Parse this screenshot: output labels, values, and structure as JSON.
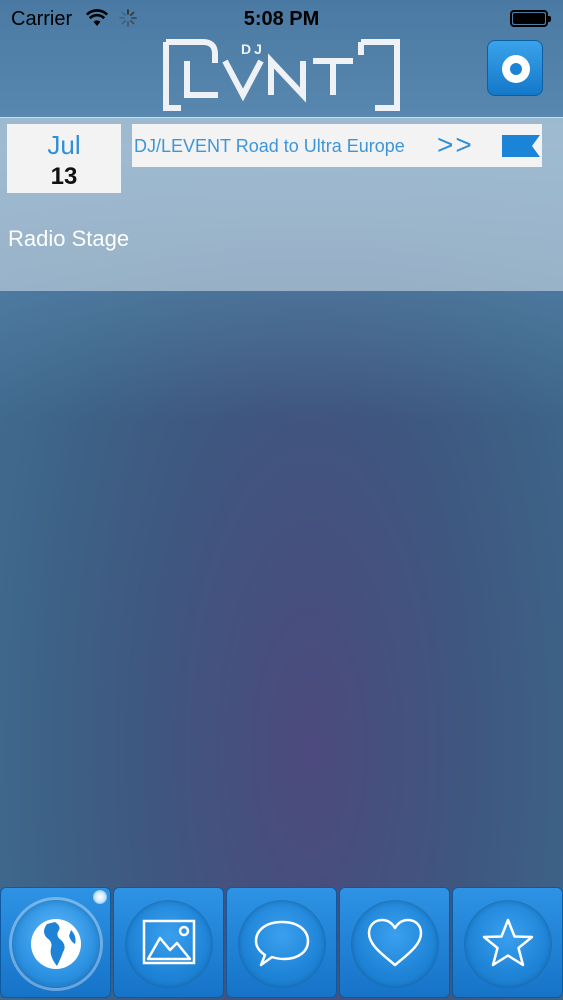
{
  "status_bar": {
    "carrier": "Carrier",
    "time": "5:08 PM"
  },
  "header": {
    "logo_text": "DJ LVNT",
    "record_icon": "record-icon"
  },
  "event": {
    "month": "Jul",
    "day": "13",
    "title": "DJ/LEVENT Road to Ultra Europe",
    "more_label": ">>",
    "venue": "Radio Stage"
  },
  "tab_bar": {
    "tabs": [
      {
        "name": "globe",
        "icon": "globe-icon",
        "active": true
      },
      {
        "name": "gallery",
        "icon": "picture-icon",
        "active": false
      },
      {
        "name": "messages",
        "icon": "speech-bubble-icon",
        "active": false
      },
      {
        "name": "favorites",
        "icon": "heart-icon",
        "active": false
      },
      {
        "name": "featured",
        "icon": "star-icon",
        "active": false
      }
    ]
  },
  "colors": {
    "accent": "#2f8fd8",
    "tab_blue": "#1c84d6"
  }
}
